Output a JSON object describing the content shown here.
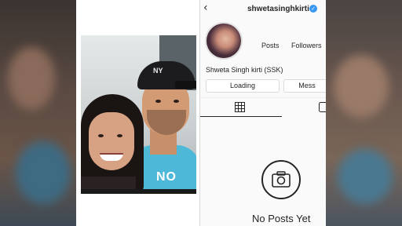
{
  "profile": {
    "username": "shwetasinghkirti",
    "verified": true,
    "stats": {
      "posts_label": "Posts",
      "followers_label": "Followers"
    },
    "display_name": "Shweta Singh kirti (SSK)",
    "buttons": {
      "follow_label": "Loading",
      "message_label": "Mess"
    },
    "empty_state": "No Posts Yet"
  },
  "photo": {
    "shirt_text": "NO",
    "cap_logo": "NY"
  },
  "colors": {
    "verified_blue": "#3897f0",
    "text_dark": "#262626",
    "panel_bg": "#fafafa"
  },
  "icons": [
    "back-chevron-icon",
    "verified-badge-icon",
    "grid-icon",
    "tagged-icon",
    "camera-icon"
  ]
}
